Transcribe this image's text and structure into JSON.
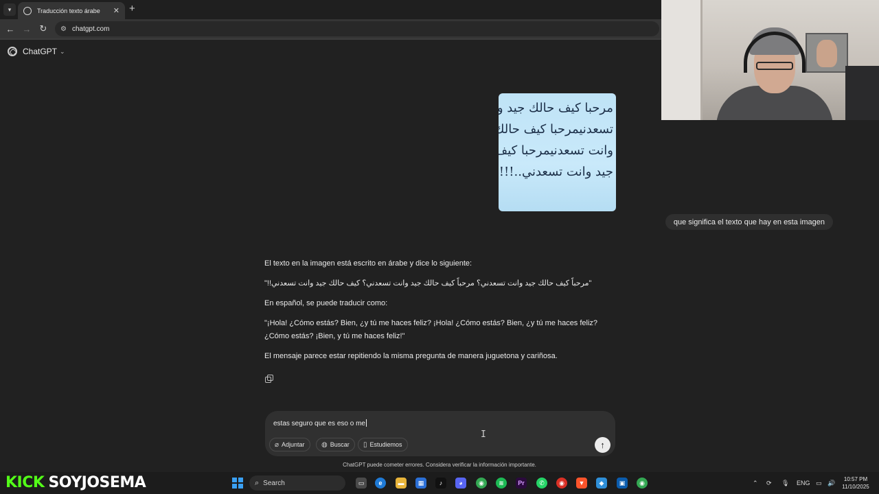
{
  "browser": {
    "tab_title": "Traducción texto árabe",
    "tab_close": "✕",
    "new_tab": "+",
    "url": "chatgpt.com"
  },
  "app": {
    "brand": "ChatGPT",
    "brand_chevron": "⌄"
  },
  "conversation": {
    "image_text_lines": [
      "مرحبا كيف حالك جيد وانت",
      "تسعدنيمرحبا كيف حالك جيد",
      "وانت تسعدنيمرحبا كيف حالك",
      "جيد وانت تسعدني..!!!!"
    ],
    "user_message": "que significa el texto que hay en esta imagen",
    "assistant_paragraphs": [
      "El texto en la imagen está escrito en árabe y dice lo siguiente:",
      "\"مرحباً كيف حالك جيد وانت تسعدني؟ مرحباً كيف حالك جيد وانت تسعدني؟ كيف حالك جيد وانت تسعدني!!\"",
      "En español, se puede traducir como:",
      "\"¡Hola! ¿Cómo estás? Bien, ¿y tú me haces feliz? ¡Hola! ¿Cómo estás? Bien, ¿y tú me haces feliz? ¿Cómo estás? ¡Bien, y tú me haces feliz!\"",
      "El mensaje parece estar repitiendo la misma pregunta de manera juguetona y cariñosa."
    ]
  },
  "composer": {
    "input_value": "estas seguro que es eso o me",
    "attach_label": "Adjuntar",
    "search_label": "Buscar",
    "study_label": "Estudiemos",
    "send_icon": "↑",
    "disclaimer": "ChatGPT puede cometer errores. Considera verificar la información importante."
  },
  "overlay": {
    "kick_word": "KICK",
    "channel": "SOYJOSEMA"
  },
  "taskbar": {
    "search_placeholder": "Search",
    "language": "ENG",
    "time": "10:57 PM",
    "date": "11/10/2025"
  },
  "colors": {
    "app_bg": "#212121",
    "bubble_bg": "#2f2f2f",
    "kick_green": "#53fc18",
    "windows_blue": "#3aa0f3"
  }
}
